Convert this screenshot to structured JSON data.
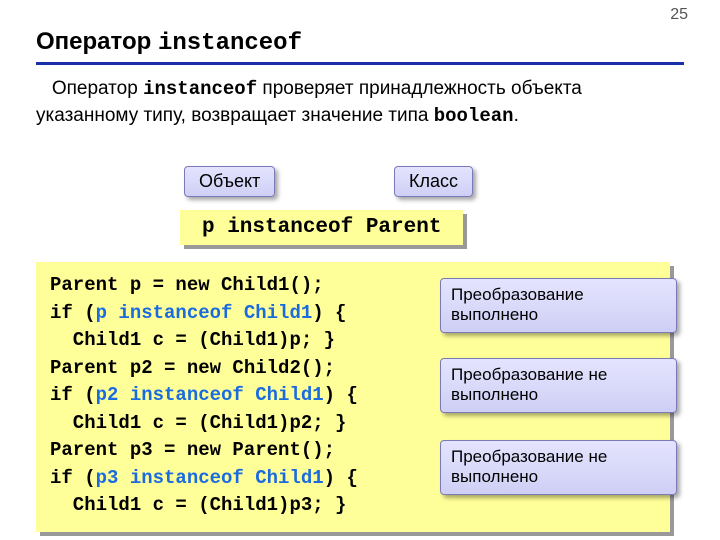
{
  "page_number": "25",
  "title_plain": "Оператор ",
  "title_mono": "instanceof",
  "body": {
    "prefix": "   Оператор ",
    "kw1": "instanceof",
    "mid": " проверяет принадлежность объекта указанному типу, возвращает значение типа ",
    "kw2": "boolean",
    "suffix": "."
  },
  "callouts": {
    "object": "Объект",
    "class": "Класс"
  },
  "expression": "p instanceof Parent",
  "code": {
    "l1": "Parent p = new Child1();",
    "l2a": "if (",
    "l2b": "p instanceof Child1",
    "l2c": ") {",
    "l3": "  Child1 c = (Child1)p; }",
    "l4": "Parent p2 = new Child2();",
    "l5a": "if (",
    "l5b": "p2 instanceof Child1",
    "l5c": ") {",
    "l6": "  Child1 c = (Child1)p2; }",
    "l7": "Parent p3 = new Parent();",
    "l8a": "if (",
    "l8b": "p3 instanceof Child1",
    "l8c": ") {",
    "l9": "  Child1 c = (Child1)p3; }"
  },
  "notes": {
    "n1": "Преобразование выполнено",
    "n2": "Преобразование не выполнено",
    "n3": "Преобразование не выполнено"
  }
}
